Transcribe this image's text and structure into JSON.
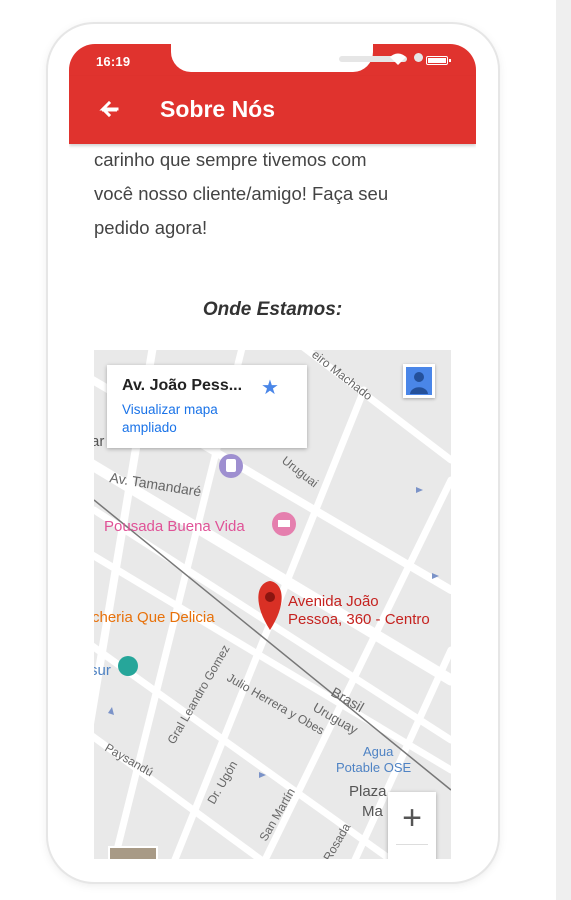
{
  "status_bar": {
    "time": "16:19"
  },
  "app_bar": {
    "title": "Sobre Nós",
    "back_icon": "arrow-back-icon"
  },
  "content": {
    "paragraph_lines": [
      "carinho que sempre tivemos com",
      "você nosso cliente/amigo! Faça seu",
      "pedido agora!"
    ],
    "location_heading": "Onde Estamos:"
  },
  "map": {
    "info_card": {
      "title": "Av. João Pess...",
      "link": "Visualizar mapa ampliado"
    },
    "marker_label_line1": "Avenida João",
    "marker_label_line2": "Pessoa, 360 - Centro",
    "street_labels": {
      "tamandare": "Av. Tamandaré",
      "uruguai_top": "Uruguai",
      "ribeiro_machado": "eiro Machado",
      "brasil": "Brasil",
      "uruguay": "Uruguay",
      "julio_herrera": "Julio Herrera y Obes",
      "leandro_gomez": "Gral Leandro Gomez",
      "paysandu": "Paysandú",
      "dr_ugon": "Dr. Ugón",
      "san_martin": "San Martín",
      "rosada": "Rosada"
    },
    "places": {
      "pousada": "Pousada Buena Vida",
      "pizzaria": "cheria Que Delicia",
      "agua_line1": "Agua",
      "agua_line2": "Potable OSE",
      "plaza_line1": "Plaza",
      "plaza_line2": "Ma",
      "left_partial_1": "ar",
      "left_partial_2": "sur"
    },
    "zoom_in_label": "+"
  }
}
